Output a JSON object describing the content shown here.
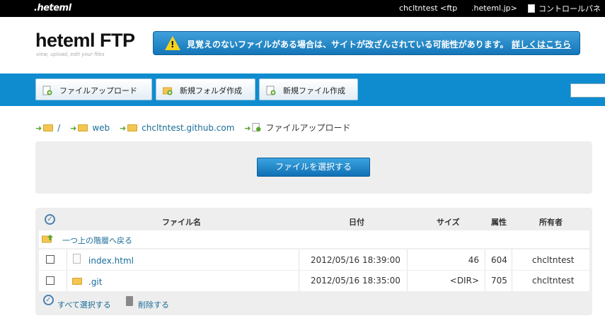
{
  "topbar": {
    "logo": ".heteml",
    "user": "chcltntest <ftp",
    "domain": ".heteml.jp>",
    "control_panel": "コントロールパネ"
  },
  "header": {
    "brand": "heteml FTP",
    "tagline": "view, upload, edit your files",
    "alert_message": "見覚えのないファイルがある場合は、サイトが改ざんされている可能性があります。",
    "alert_link": "詳しくはこちら"
  },
  "toolbar": {
    "upload": "ファイルアップロード",
    "new_folder": "新規フォルダ作成",
    "new_file": "新規ファイル作成"
  },
  "breadcrumb": {
    "root": "/",
    "web": "web",
    "site": "chcltntest.github.com",
    "current": "ファイルアップロード"
  },
  "upload_panel": {
    "select_button": "ファイルを選択する"
  },
  "table": {
    "headers": {
      "name": "ファイル名",
      "date": "日付",
      "size": "サイズ",
      "perm": "属性",
      "owner": "所有者"
    },
    "up_label": "一つ上の階層へ戻る",
    "rows": [
      {
        "name": "index.html",
        "date": "2012/05/16 18:39:00",
        "size": "46",
        "perm": "604",
        "owner": "chcltntest"
      },
      {
        "name": ".git",
        "date": "2012/05/16 18:35:00",
        "size": "<DIR>",
        "perm": "705",
        "owner": "chcltntest"
      }
    ],
    "select_all": "すべて選択する",
    "delete": "削除する"
  }
}
